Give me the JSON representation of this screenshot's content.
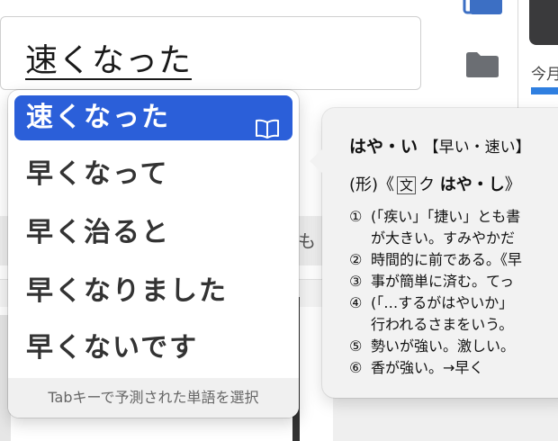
{
  "text_field": {
    "value": "速くなった"
  },
  "sidebar": {
    "month_label": "今月"
  },
  "background": {
    "partial_text": "も"
  },
  "candidates": {
    "items": [
      "速くなった",
      "早くなって",
      "早く治ると",
      "早くなりました",
      "早くないです"
    ],
    "selected_index": 0,
    "footer": "Tabキーで予測された単語を選択"
  },
  "dictionary": {
    "headword": "はや・い",
    "kanji": "【早い・速い】",
    "pos_prefix": "(形)《",
    "pos_box": "文",
    "pos_suffix": "ク",
    "pos_bold": "はや・し",
    "pos_close": "》",
    "definitions": [
      {
        "num": "①",
        "lines": [
          "(「疾い」「捷い」とも書",
          "が大きい。すみやかだ"
        ]
      },
      {
        "num": "②",
        "lines": [
          "時間的に前である。《早"
        ]
      },
      {
        "num": "③",
        "lines": [
          "事が簡単に済む。てっ"
        ]
      },
      {
        "num": "④",
        "lines": [
          "(「…するがはやいか」",
          "行われるさまをいう。"
        ]
      },
      {
        "num": "⑤",
        "lines": [
          "勢いが強い。激しい。"
        ]
      },
      {
        "num": "⑥",
        "lines": [
          "香が強い。→早く"
        ]
      }
    ]
  },
  "colors": {
    "selection": "#2b5fd9",
    "accent_bar": "#2f7fe0"
  }
}
